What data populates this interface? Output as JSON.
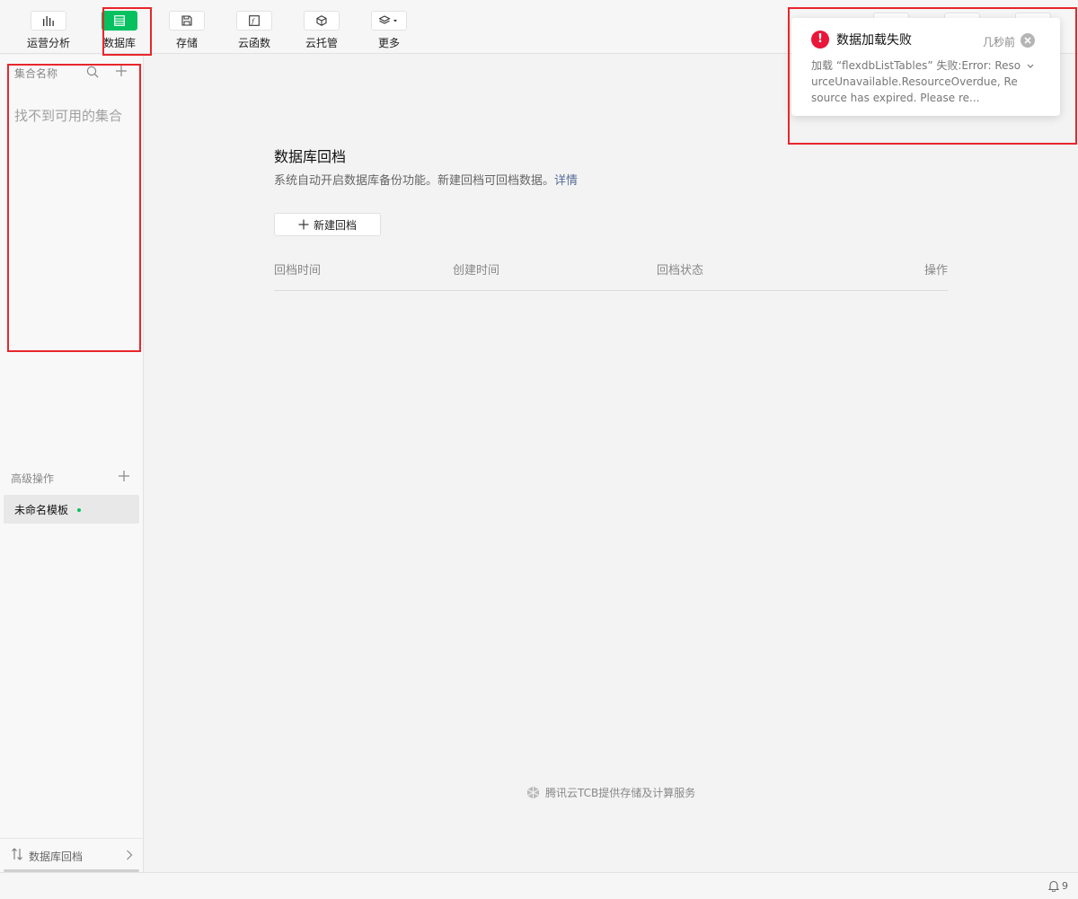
{
  "toolbar": {
    "items": [
      {
        "label": "运营分析",
        "icon": "bar-chart-icon"
      },
      {
        "label": "数据库",
        "icon": "database-icon"
      },
      {
        "label": "存储",
        "icon": "save-icon"
      },
      {
        "label": "云函数",
        "icon": "function-icon"
      },
      {
        "label": "云托管",
        "icon": "cube-icon"
      },
      {
        "label": "更多",
        "icon": "layers-icon"
      }
    ],
    "active_color": "#07c160"
  },
  "sidebar": {
    "collections_header": "集合名称",
    "collections_empty": "找不到可用的集合",
    "advanced_header": "高级操作",
    "template_item": "未命名模板",
    "footer_link": "数据库回档"
  },
  "main": {
    "title": "数据库回档",
    "description": "系统自动开启数据库备份功能。新建回档可回档数据。",
    "details_link": "详情",
    "new_button": "新建回档",
    "columns": [
      "回档时间",
      "创建时间",
      "回档状态",
      "操作"
    ],
    "powered_by": "腾讯云TCB提供存储及计算服务"
  },
  "notification": {
    "title": "数据加载失败",
    "time": "几秒前",
    "message": "加载 “flexdbListTables” 失败:Error: ResourceUnavailable.ResourceOverdue, Resource has expired. Please re...",
    "error_color": "#e9163a"
  },
  "statusbar": {
    "notification_count": "9"
  }
}
